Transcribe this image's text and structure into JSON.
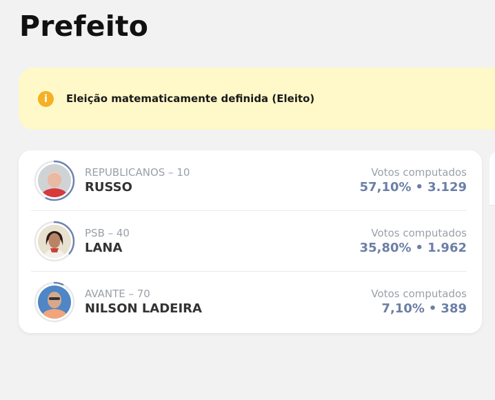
{
  "page": {
    "title": "Prefeito"
  },
  "notice": {
    "icon": "info-icon",
    "text": "Eleição matematicamente definida (Eleito)",
    "color": "#fff8c8"
  },
  "colors": {
    "accent": "#6b7fa6",
    "ring": "#7083b0",
    "notice_icon": "#f5b026"
  },
  "candidates": [
    {
      "party": "REPUBLICANOS – 10",
      "name": "RUSSO",
      "votes_label": "Votos computados",
      "percent": "57,10%",
      "separator": "•",
      "votes": "3.129",
      "share": 0.571
    },
    {
      "party": "PSB – 40",
      "name": "LANA",
      "votes_label": "Votos computados",
      "percent": "35,80%",
      "separator": "•",
      "votes": "1.962",
      "share": 0.358
    },
    {
      "party": "AVANTE – 70",
      "name": "NILSON LADEIRA",
      "votes_label": "Votos computados",
      "percent": "7,10%",
      "separator": "•",
      "votes": "389",
      "share": 0.071
    }
  ]
}
